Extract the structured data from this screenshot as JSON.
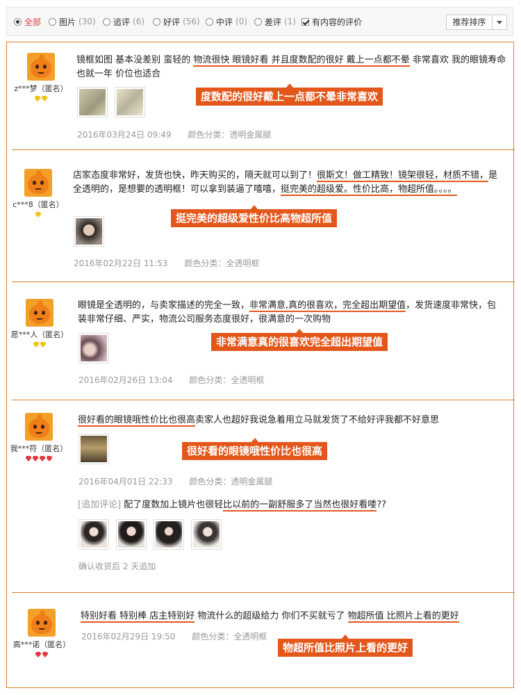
{
  "filter": {
    "items": [
      {
        "label": "全部",
        "count": "",
        "active": true
      },
      {
        "label": "图片",
        "count": "(30)"
      },
      {
        "label": "追评",
        "count": "(6)"
      },
      {
        "label": "好评",
        "count": "(56)"
      },
      {
        "label": "中评",
        "count": "(0)"
      },
      {
        "label": "差评",
        "count": "(1)"
      }
    ],
    "with_content_label": "有内容的评价",
    "sort_label": "推荐排序"
  },
  "reviews": [
    {
      "user": "z***梦（匿名）",
      "badge_color": "yellow",
      "badge_count": 2,
      "text_parts": [
        {
          "t": "镜框如图 基本没差别 蛮轻的 "
        },
        {
          "t": "物流很快 眼镜好看 并且度数配的很好 戴上一点都不晕",
          "u": true
        },
        {
          "t": " 非常喜欢 我的眼镜寿命也就一年 价位也适合"
        }
      ],
      "date": "2016年03月24日 09:49",
      "color_category": "颜色分类：透明金属腿",
      "callout": "度数配的很好戴上一点都不晕非常喜欢"
    },
    {
      "user": "c***8（匿名）",
      "badge_color": "yellow",
      "badge_count": 1,
      "text_parts": [
        {
          "t": "店家态度非常好，发货也快，昨天购买的，隔天就可以到了！"
        },
        {
          "t": "很斯文！做工精致！镜架很轻，材质不错，",
          "u": true
        },
        {
          "t": "是全透明的，是想要的透明框！可以拿到装逼了嘻嘻，"
        },
        {
          "t": "挺完美的超级爱。性价比高，物超所值。。。。",
          "u": true
        }
      ],
      "date": "2016年02月22日 11:53",
      "color_category": "颜色分类：全透明框",
      "callout": "挺完美的超级爱性价比高物超所值"
    },
    {
      "user": "愿***人（匿名）",
      "badge_color": "yellow",
      "badge_count": 2,
      "text_parts": [
        {
          "t": "眼镜是全透明的，与卖家描述的完全一致，"
        },
        {
          "t": "非常满意,真的很喜欢，完全超出期望值",
          "u": true
        },
        {
          "t": "，发货速度非常快，包装非常仔细、严实，物流公司服务态度很好，很满意的一次购物"
        }
      ],
      "date": "2016年02月26日 13:04",
      "color_category": "颜色分类：全透明框",
      "callout": "非常满意真的很喜欢完全超出期望值"
    },
    {
      "user": "我***符（匿名）",
      "badge_color": "red",
      "badge_count": 4,
      "text_parts": [
        {
          "t": "很好看的眼镜哦性价比也很高",
          "u": true
        },
        {
          "t": "卖家人也超好我说急着用立马就发货了不给好评我都不好意思"
        }
      ],
      "date": "2016年04月01日 22:33",
      "color_category": "颜色分类：透明金属腿",
      "callout": "很好看的眼镜哦性价比也很高",
      "append_tag": "[追加评论]",
      "append_parts": [
        {
          "t": " 配了度数加上镜片也很轻"
        },
        {
          "t": "比以前的一副舒服多了当然也很好看喽",
          "u": true
        },
        {
          "t": "??"
        }
      ],
      "append_note": "确认收货后 2 天追加"
    },
    {
      "user": "高***诺（匿名）",
      "badge_color": "red",
      "badge_count": 2,
      "text_parts": [
        {
          "t": "特别好看 特别棒 店主特别好",
          "u": true
        },
        {
          "t": " 物流什么的超级给力 你们不买就亏了 "
        },
        {
          "t": "物超所值 比照片上看的更好",
          "u": true
        }
      ],
      "date": "2016年02月29日 19:50",
      "color_category": "颜色分类：全透明框",
      "callout": "物超所值比照片上看的更好"
    }
  ]
}
